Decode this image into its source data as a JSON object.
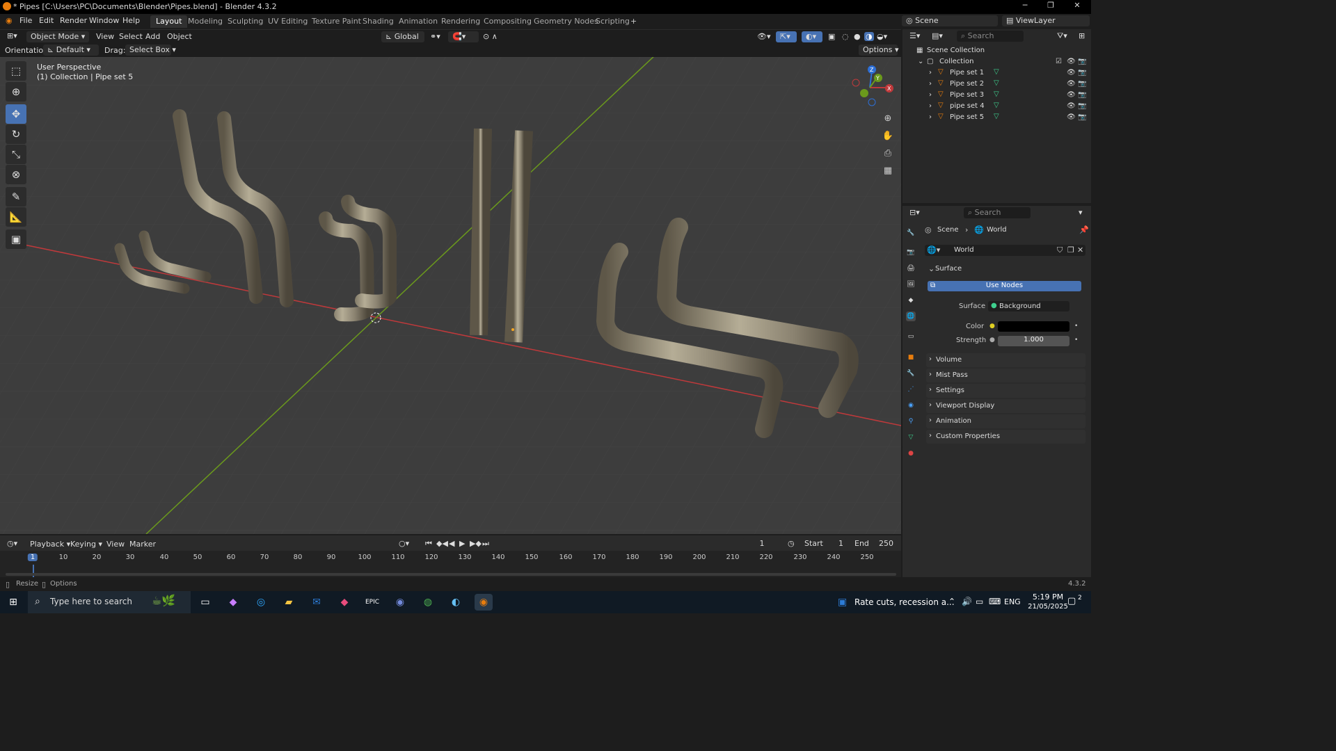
{
  "window": {
    "title": "* Pipes [C:\\Users\\PC\\Documents\\Blender\\Pipes.blend] - Blender 4.3.2",
    "minimize": "─",
    "maximize": "❐",
    "close": "✕"
  },
  "menu": {
    "file": "File",
    "edit": "Edit",
    "render": "Render",
    "window": "Window",
    "help": "Help"
  },
  "workspaces": [
    "Layout",
    "Modeling",
    "Sculpting",
    "UV Editing",
    "Texture Paint",
    "Shading",
    "Animation",
    "Rendering",
    "Compositing",
    "Geometry Nodes",
    "Scripting"
  ],
  "scene": {
    "label": "Scene",
    "view_layer": "ViewLayer"
  },
  "viewport_header": {
    "mode": "Object Mode",
    "view": "View",
    "select": "Select",
    "add": "Add",
    "object": "Object",
    "transform": "Global"
  },
  "tool_settings": {
    "orientation_label": "Orientation:",
    "orientation": "Default",
    "drag_label": "Drag:",
    "drag": "Select Box",
    "options": "Options"
  },
  "viewport": {
    "perspective": "User Perspective",
    "collection": "(1) Collection | Pipe set 5"
  },
  "outliner": {
    "search_placeholder": "Search",
    "scene_collection": "Scene Collection",
    "collection": "Collection",
    "items": [
      "Pipe set 1",
      "Pipe set 2",
      "Pipe set 3",
      "pipe set 4",
      "Pipe set 5"
    ]
  },
  "properties": {
    "search_placeholder": "Search",
    "breadcrumb_scene": "Scene",
    "breadcrumb_world": "World",
    "world_name": "World",
    "surface_panel": "Surface",
    "use_nodes": "Use Nodes",
    "surface_label": "Surface",
    "surface_value": "Background",
    "color_label": "Color",
    "strength_label": "Strength",
    "strength_value": "1.000",
    "panels": [
      "Volume",
      "Mist Pass",
      "Settings",
      "Viewport Display",
      "Animation",
      "Custom Properties"
    ]
  },
  "timeline": {
    "playback": "Playback",
    "keying": "Keying",
    "view": "View",
    "marker": "Marker",
    "current_frame": "1",
    "start_label": "Start",
    "start": "1",
    "end_label": "End",
    "end": "250",
    "ticks": [
      "1",
      "10",
      "20",
      "30",
      "40",
      "50",
      "60",
      "70",
      "80",
      "90",
      "100",
      "110",
      "120",
      "130",
      "140",
      "150",
      "160",
      "170",
      "180",
      "190",
      "200",
      "210",
      "220",
      "230",
      "240",
      "250"
    ]
  },
  "status": {
    "resize": "Resize",
    "options": "Options",
    "version": "4.3.2"
  },
  "taskbar": {
    "search_placeholder": "Type here to search",
    "news": "Rate cuts, recession a...",
    "lang": "ENG",
    "time": "5:19 PM",
    "date": "21/05/2025",
    "notifications": "2"
  },
  "colors": {
    "accent": "#4772b3",
    "x_axis": "#c0393b",
    "y_axis": "#6b9a1c",
    "z_axis": "#2d6fd6",
    "blender_orange": "#e87d0d"
  }
}
